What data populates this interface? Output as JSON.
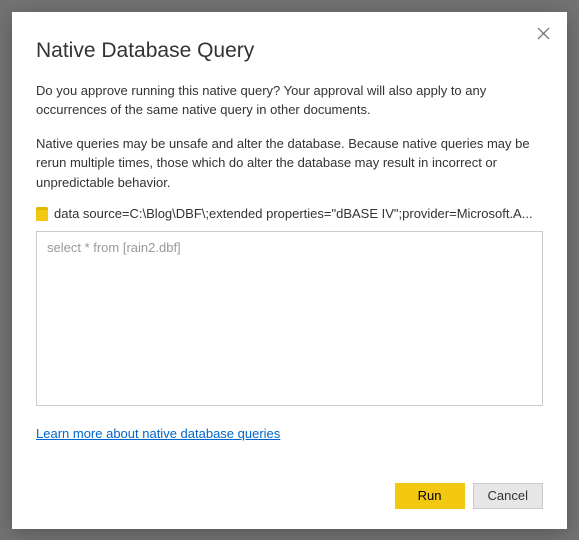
{
  "dialog": {
    "title": "Native Database Query",
    "paragraph1": "Do you approve running this native query? Your approval will also apply to any occurrences of the same native query in other documents.",
    "paragraph2": "Native queries may be unsafe and alter the database. Because native queries may be rerun multiple times, those which do alter the database may result in incorrect or unpredictable behavior.",
    "data_source_text": "data source=C:\\Blog\\DBF\\;extended properties=\"dBASE IV\";provider=Microsoft.A...",
    "query_text": "select * from [rain2.dbf]",
    "learn_more_label": "Learn more about native database queries",
    "run_label": "Run",
    "cancel_label": "Cancel"
  },
  "icons": {
    "database": "database-icon",
    "close": "close-icon"
  }
}
